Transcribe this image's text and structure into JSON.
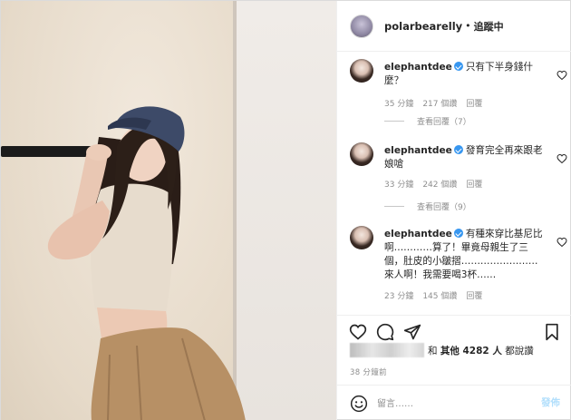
{
  "header": {
    "username": "polarbearelly",
    "separator": "•",
    "follow_status": "追蹤中"
  },
  "comments": [
    {
      "username": "elephantdee",
      "verified": true,
      "text": "只有下半身錢什麼？",
      "time": "35 分鐘",
      "likes": "217 個讚",
      "reply": "回覆",
      "view_replies": "查看回覆（7）"
    },
    {
      "username": "elephantdee",
      "verified": true,
      "text": "發育完全再來跟老娘嗆",
      "time": "33 分鐘",
      "likes": "242 個讚",
      "reply": "回覆",
      "view_replies": "查看回覆（9）"
    },
    {
      "username": "elephantdee",
      "verified": true,
      "text": "有種來穿比基尼比啊…………算了！畢竟母親生了三個，肚皮的小皺摺……………………來人啊！我需要喝3杯……",
      "time": "23 分鐘",
      "likes": "145 個讚",
      "reply": "回覆",
      "view_replies": ""
    }
  ],
  "likes": {
    "prefix": "和",
    "others": "其他 4282 人",
    "suffix": "都說讚"
  },
  "time_ago": "38 分鐘前",
  "add_comment": {
    "placeholder": "留言……",
    "post_label": "發佈"
  },
  "icons": {
    "like": "heart-icon",
    "comment": "comment-icon",
    "share": "paper-plane-icon",
    "save": "bookmark-icon",
    "emoji": "smile-icon"
  },
  "colors": {
    "verified": "#3897f0",
    "post_button": "#b2dffc",
    "muted": "#8e8e8e"
  }
}
